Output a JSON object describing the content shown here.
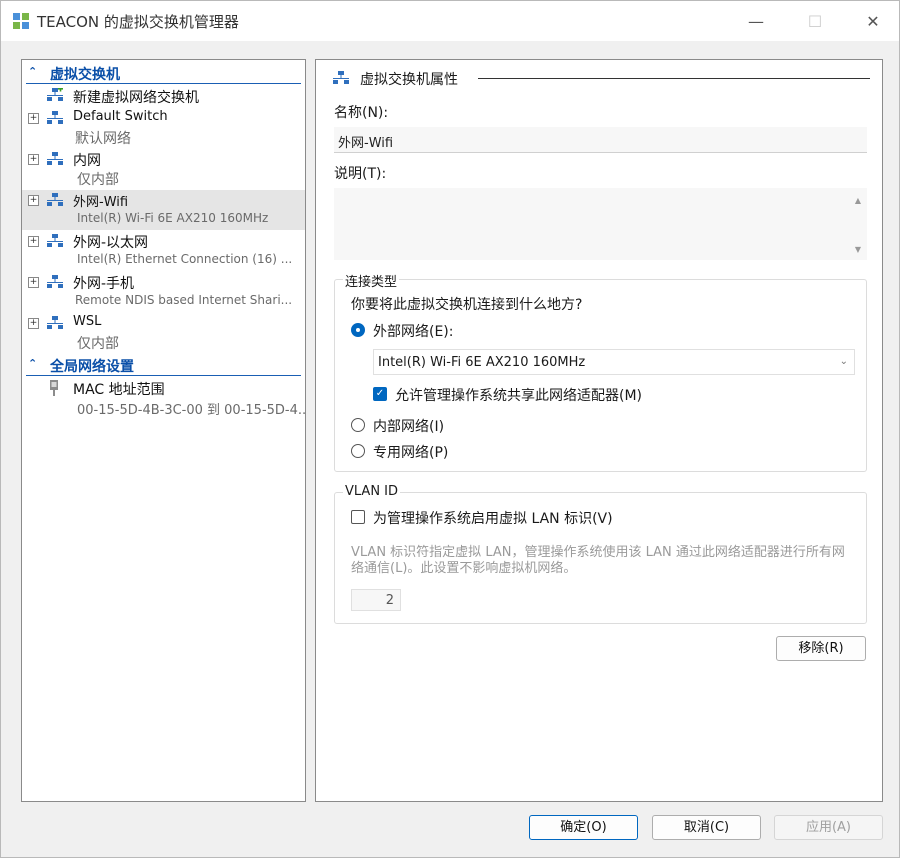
{
  "window": {
    "title": "TEACON 的虚拟交换机管理器",
    "controls": {
      "minimize": "—",
      "maximize": "☐",
      "close": "✕"
    }
  },
  "left_pane": {
    "switches_header": "虚拟交换机",
    "new_switch": "新建虚拟网络交换机",
    "items": [
      {
        "name": "Default Switch",
        "sub": "默认网络"
      },
      {
        "name": "内网",
        "sub": "仅内部"
      },
      {
        "name": "外网-Wifi",
        "sub": "Intel(R) Wi-Fi 6E AX210 160MHz"
      },
      {
        "name": "外网-以太网",
        "sub": "Intel(R) Ethernet Connection (16) ..."
      },
      {
        "name": "外网-手机",
        "sub": "Remote NDIS based Internet Shari..."
      },
      {
        "name": "WSL",
        "sub": "仅内部"
      }
    ],
    "global_header": "全局网络设置",
    "mac": {
      "name": "MAC 地址范围",
      "sub": "00-15-5D-4B-3C-00 到 00-15-5D-4..."
    }
  },
  "right_pane": {
    "header": "虚拟交换机属性",
    "name_label": "名称(N):",
    "name_value": "外网-Wifi",
    "desc_label": "说明(T):",
    "desc_value": "",
    "connection": {
      "title": "连接类型",
      "question": "你要将此虚拟交换机连接到什么地方?",
      "external_label": "外部网络(E):",
      "adapter": "Intel(R) Wi-Fi 6E AX210 160MHz",
      "allow_share": "允许管理操作系统共享此网络适配器(M)",
      "internal_label": "内部网络(I)",
      "private_label": "专用网络(P)"
    },
    "vlan": {
      "title": "VLAN ID",
      "enable_label": "为管理操作系统启用虚拟 LAN 标识(V)",
      "description": "VLAN 标识符指定虚拟 LAN，管理操作系统使用该 LAN 通过此网络适配器进行所有网络通信(L)。此设置不影响虚拟机网络。",
      "value": "2"
    },
    "remove_button": "移除(R)"
  },
  "footer": {
    "ok": "确定(O)",
    "cancel": "取消(C)",
    "apply": "应用(A)"
  },
  "colors": {
    "accent": "#0067c0",
    "header_blue": "#0a4fa8"
  }
}
